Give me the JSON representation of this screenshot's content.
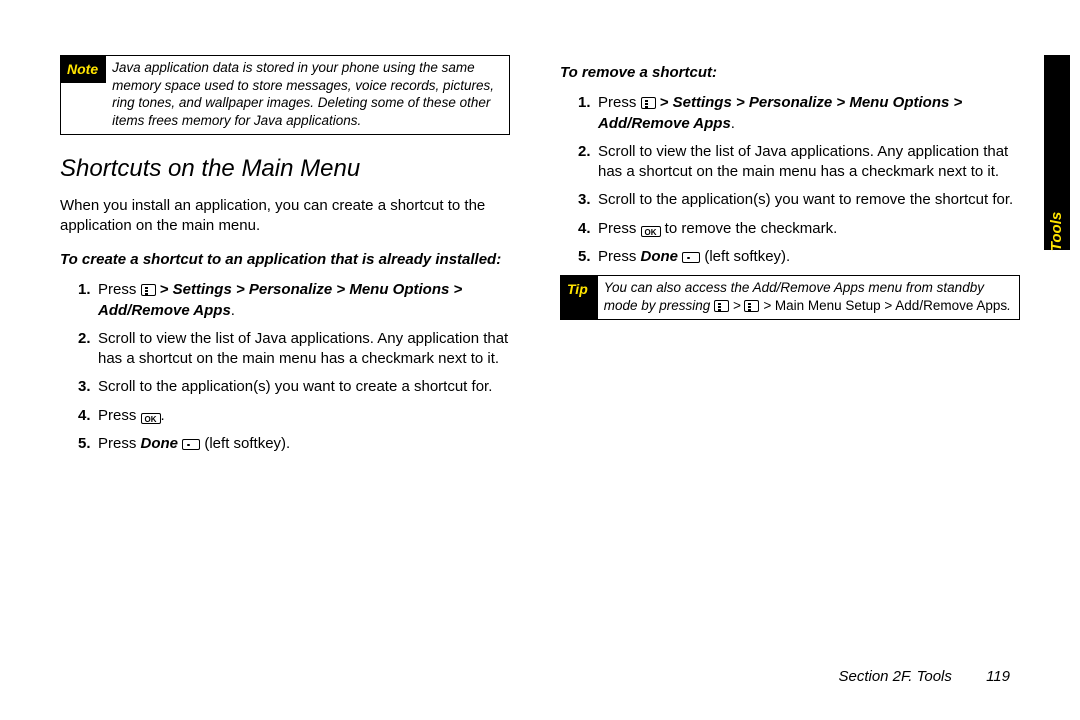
{
  "sideTab": "Tools",
  "footer": {
    "section": "Section 2F. Tools",
    "page": "119"
  },
  "left": {
    "note": {
      "label": "Note",
      "body": "Java application data is stored in your phone using the same memory space used to store messages, voice records, pictures, ring tones, and wallpaper images. Deleting some of these other items frees memory for Java applications."
    },
    "heading": "Shortcuts on the Main Menu",
    "intro": "When you install an application, you can create a shortcut to the application on the main menu.",
    "sub": "To create a shortcut to an application that is already installed:",
    "steps": {
      "s1a": "Press ",
      "s1b": " > Settings > Personalize > Menu Options > Add/Remove Apps",
      "s1c": ".",
      "s2": "Scroll to view the list of Java applications. Any application that has a shortcut on the main menu has a checkmark next to it.",
      "s3": "Scroll to the application(s) you want to create a shortcut for.",
      "s4a": "Press ",
      "s4b": ".",
      "s5a": "Press ",
      "s5b": "Done",
      "s5c": " (left softkey)."
    }
  },
  "right": {
    "sub": "To remove a shortcut:",
    "steps": {
      "s1a": "Press ",
      "s1b": " > Settings > Personalize > Menu Options > Add/Remove Apps",
      "s1c": ".",
      "s2": "Scroll to view the list of Java applications. Any application that has a shortcut on the main menu has a checkmark next to it.",
      "s3": "Scroll to the application(s) you want to remove the shortcut for.",
      "s4a": "Press ",
      "s4b": " to remove the checkmark.",
      "s5a": "Press ",
      "s5b": "Done",
      "s5c": " (left softkey)."
    },
    "tip": {
      "label": "Tip",
      "part1": "You can also access the Add/Remove Apps menu from standby mode by pressing ",
      "part2": " > ",
      "part3": " > ",
      "nonitalic": "Main Menu Setup > Add/Remove Apps",
      "part4": "."
    }
  }
}
